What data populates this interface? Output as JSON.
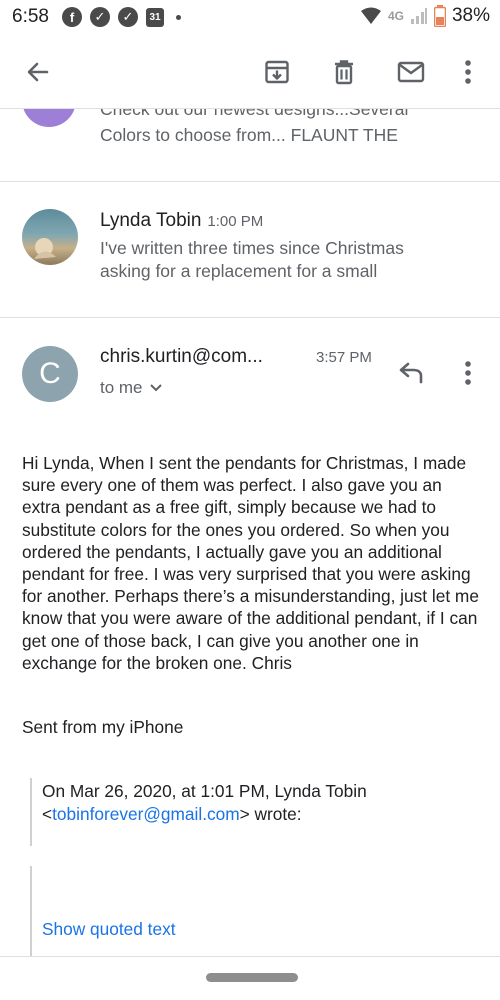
{
  "status_bar": {
    "time": "6:58",
    "calendar_day": "31",
    "network": "4G",
    "battery": "38%"
  },
  "app_bar": {
    "icons": [
      "back-arrow-icon",
      "archive-icon",
      "delete-icon",
      "mark-unread-icon",
      "more-vert-icon"
    ]
  },
  "thread": {
    "top_preview": {
      "line1": "Check out our newest designs...Several",
      "line2": "Colors to choose from... FLAUNT THE"
    },
    "lynda_message": {
      "sender": "Lynda Tobin",
      "time": "1:00 PM",
      "preview_line1": "I've written three times since Christmas",
      "preview_line2": "asking for a replacement for a small"
    },
    "open_message": {
      "avatar_letter": "C",
      "sender": "chris.kurtin@com...",
      "time": "3:57 PM",
      "recipient": "to me",
      "body": "Hi Lynda,  When I sent the pendants for Christmas, I made sure every one of them was perfect. I also gave you an extra pendant as a free gift, simply because we had to substitute colors for the ones you ordered. So when you ordered the pendants, I actually gave you an additional pendant for free. I was very surprised that you were asking for another. Perhaps there’s a misunderstanding, just let me know that you were aware of the additional pendant, if I can get one of those back, I can give you another one in exchange for the broken one.  Chris",
      "signature": "Sent from my iPhone",
      "quote_header_line1": "On Mar 26, 2020, at 1:01 PM, Lynda Tobin",
      "quote_open": "<",
      "quote_email": "tobinforever@gmail.com",
      "quote_close": "> wrote:",
      "show_quoted": "Show quoted text"
    }
  },
  "colors": {
    "accent_link": "#1a73e8",
    "avatar_c": "#8da3ad",
    "avatar_top": "#9e7fd8"
  }
}
